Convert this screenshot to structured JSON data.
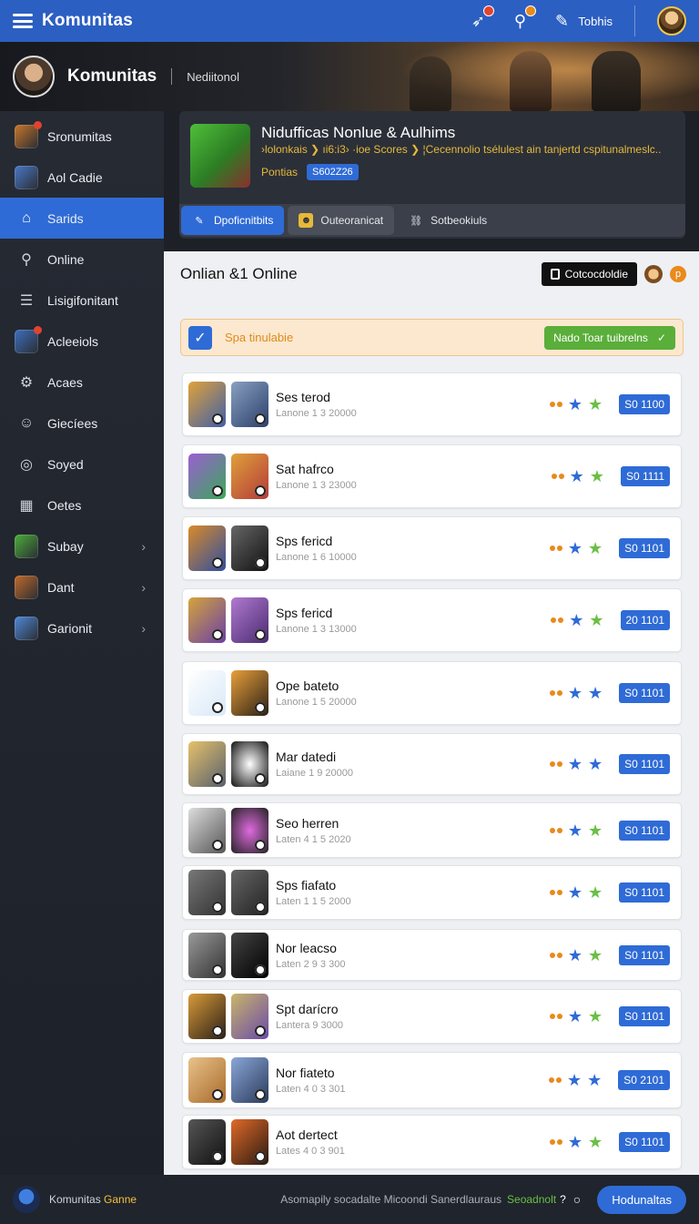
{
  "topbar": {
    "title": "Komunitas",
    "user_label": "Tobhis"
  },
  "hero": {
    "name": "Komunitas",
    "subtitle": "Nediitonol"
  },
  "sidebar": {
    "items": [
      {
        "label": "Sronumitas",
        "icon": "game-icon",
        "active": false,
        "chevron": false
      },
      {
        "label": "Aol Cadie",
        "icon": "game-icon",
        "active": false,
        "chevron": false
      },
      {
        "label": "Sarids",
        "icon": "store-icon",
        "active": true,
        "chevron": false
      },
      {
        "label": "Online",
        "icon": "search-icon",
        "active": false,
        "chevron": false
      },
      {
        "label": "Lisigifonitant",
        "icon": "list-icon",
        "active": false,
        "chevron": false
      },
      {
        "label": "Acleeiols",
        "icon": "game-icon",
        "active": false,
        "chevron": false
      },
      {
        "label": "Acaes",
        "icon": "gear-icon",
        "active": false,
        "chevron": false
      },
      {
        "label": "Giecíees",
        "icon": "user-icon",
        "active": false,
        "chevron": false
      },
      {
        "label": "Soyed",
        "icon": "compass-icon",
        "active": false,
        "chevron": false
      },
      {
        "label": "Oetes",
        "icon": "grid-icon",
        "active": false,
        "chevron": false
      },
      {
        "label": "Subay",
        "icon": "game-icon",
        "active": false,
        "chevron": true
      },
      {
        "label": "Dant",
        "icon": "game-icon",
        "active": false,
        "chevron": true
      },
      {
        "label": "Garionit",
        "icon": "game-icon",
        "active": false,
        "chevron": true
      }
    ]
  },
  "game": {
    "title": "Nidufficas Nonlue & Aulhims",
    "desc": "›lolonkais ❯ ıi6:i3› ·ioe Scores ❯ ¦Cecennolio tsélulest ain tanjertd cspitunalmeslc..",
    "meta_label": "Pontias",
    "meta_badge": "S602Z26",
    "tabs": [
      {
        "label": "Dpoficnitbits",
        "icon": "edit-icon",
        "style": "active"
      },
      {
        "label": "Outeoranicat",
        "icon": "chat-icon",
        "style": "mid"
      },
      {
        "label": "Sotbeokiuls",
        "icon": "link-icon",
        "style": "plain"
      }
    ]
  },
  "content": {
    "title": "Onlian &1 Online",
    "dark_button": "Cotcocdoldie"
  },
  "notice": {
    "text": "Spa tinulabie",
    "button": "Nado Toar tuibrelns"
  },
  "rows": [
    {
      "name": "Ses terod",
      "sub": "Lanone 1 3 20000",
      "badge": "S0 1100"
    },
    {
      "name": "Sat hafrco",
      "sub": "Lanone 1 3 23000",
      "badge": "S0 1111"
    },
    {
      "name": "Sps fericd",
      "sub": "Lanone 1 6 10000",
      "badge": "S0 1101"
    },
    {
      "name": "Sps fericd",
      "sub": "Lanone 1 3 13000",
      "badge": "20 1101"
    },
    {
      "name": "Ope bateto",
      "sub": "Lanone 1 5 20000",
      "badge": "S0 1101"
    },
    {
      "name": "Mar datedi",
      "sub": "Laiane 1 9 20000",
      "badge": "S0 1101"
    },
    {
      "name": "Seo herren",
      "sub": "Laten 4 1 5 2020",
      "badge": "S0 1101"
    },
    {
      "name": "Sps fiafato",
      "sub": "Laten 1 1 5 2000",
      "badge": "S0 1101"
    },
    {
      "name": "Nor leacso",
      "sub": "Laten 2 9 3 300",
      "badge": "S0 1101"
    },
    {
      "name": "Spt darícro",
      "sub": "Lantera 9 3000",
      "badge": "S0 1101"
    },
    {
      "name": "Nor fiateto",
      "sub": "Laten 4 0 3 301",
      "badge": "S0 2101"
    },
    {
      "name": "Aot dertect",
      "sub": "Lates 4 0 3 901",
      "badge": "S0 1101"
    }
  ],
  "footer": {
    "brand": "Komunitas",
    "brand_accent": "Ganne",
    "note": "Asomapily socadalte Micoondi Sanerdlauraus",
    "link": "Seoadnolt",
    "q": "?",
    "button": "Hodunaltas"
  },
  "colors": {
    "primary": "#2f6bd6",
    "sidebar": "#262a33",
    "accent_orange": "#e88a1c",
    "accent_green": "#6abf45",
    "accent_gold": "#e6b93b"
  }
}
